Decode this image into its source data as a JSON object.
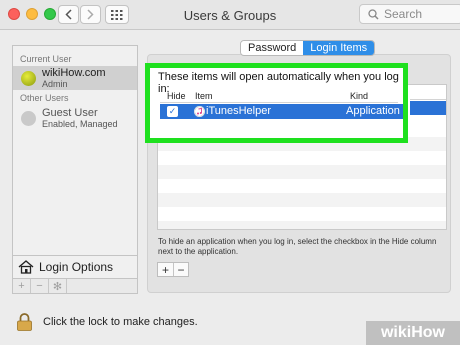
{
  "window": {
    "title": "Users & Groups"
  },
  "search": {
    "placeholder": "Search"
  },
  "sidebar": {
    "current_user_header": "Current User",
    "current_user": {
      "name": "wikiHow.com",
      "role": "Admin"
    },
    "other_users_header": "Other Users",
    "other_users": [
      {
        "name": "Guest User",
        "detail": "Enabled, Managed"
      }
    ],
    "login_options_label": "Login Options"
  },
  "tabs": [
    {
      "label": "Password",
      "active": false
    },
    {
      "label": "Login Items",
      "active": true
    }
  ],
  "login_items": {
    "message": "These items will open automatically when you log in:",
    "columns": {
      "hide": "Hide",
      "item": "Item",
      "kind": "Kind"
    },
    "rows": [
      {
        "hide_checked": true,
        "item": "iTunesHelper",
        "kind": "Application",
        "icon": "itunes-icon"
      }
    ],
    "help_text": "To hide an application when you log in, select the checkbox in the Hide column next to the application.",
    "add_label": "+",
    "remove_label": "−"
  },
  "lock": {
    "text": "Click the lock to make changes.",
    "icon": "lock-icon"
  },
  "watermark": {
    "brand": "wikiHow"
  },
  "colors": {
    "highlight": "#1ee01e",
    "selection": "#2a72d6",
    "tab_active": "#2f8ee8"
  }
}
